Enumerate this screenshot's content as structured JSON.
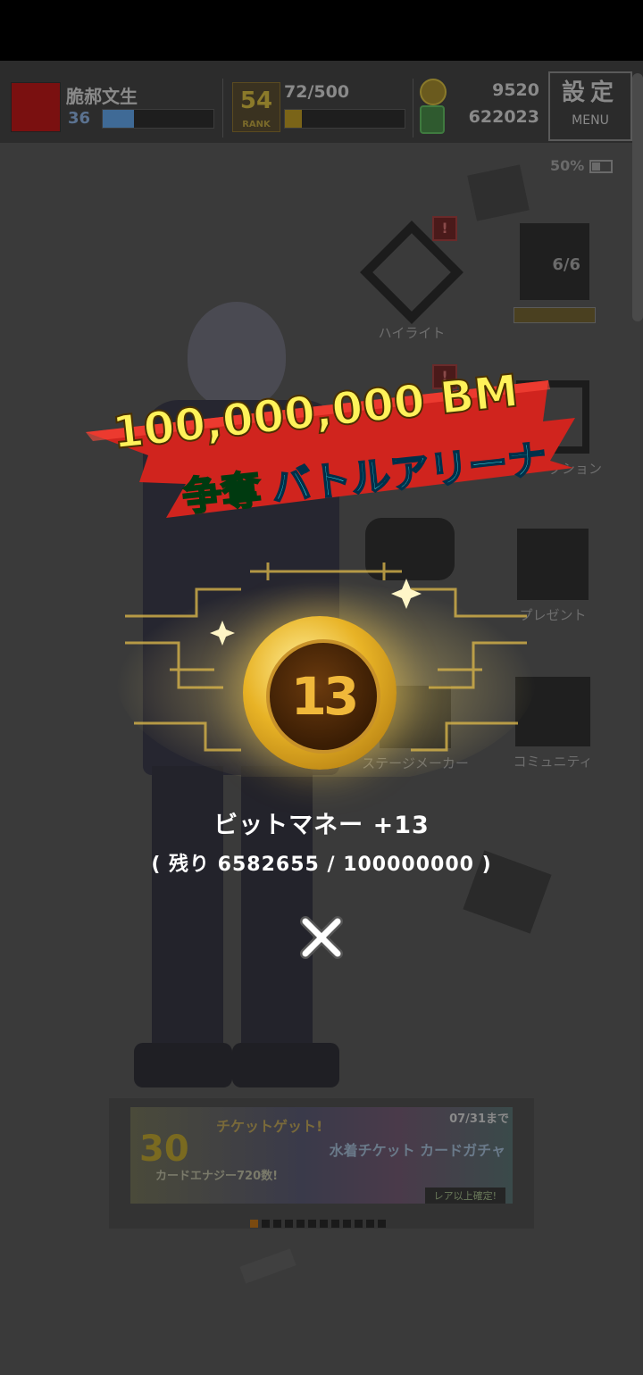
{
  "hud": {
    "player_name": "脆郝文生",
    "level": "36",
    "level_progress": 0.28,
    "rank_number": "54",
    "rank_caption": "RANK",
    "exp": "72/500",
    "exp_progress": 0.144,
    "money": "9520",
    "cans": "622023",
    "settings_jp": "設定",
    "settings_en": "MENU",
    "battery": "50%"
  },
  "menu": {
    "highlight": "ハイライト",
    "stamp": "6/6",
    "collection": "クション",
    "present": "プレゼント",
    "stage_maker": "ステージメーカー",
    "community": "コミュニティ"
  },
  "banner": {
    "big_num": "30",
    "ticket_get": "チケットゲット!",
    "sub_text": "カードエナジー720数!",
    "date": "07/31まで",
    "title": "水着チケット カードガチャ",
    "note": "レア以上確定!",
    "page_count": 12,
    "active_page": 0
  },
  "popup": {
    "headline_top": "100,000,000 BM",
    "headline_yellow": "争奪",
    "headline_cyan": "バトルアリーナ",
    "coin_value": "13",
    "reward_text": "ビットマネー +13",
    "remaining_text": "( 残り 6582655 / 100000000 )"
  },
  "colors": {
    "statusbar": "#000000",
    "background": "#3a3a3a",
    "ribbon_red": "#d0241e",
    "headline_yellow": "#fff25a",
    "headline_green": "#3dff62",
    "headline_cyan": "#42f4ff",
    "coin_gold": "#e8b326",
    "exp_fill": "#7a6418",
    "level_fill": "#3f6a96"
  }
}
